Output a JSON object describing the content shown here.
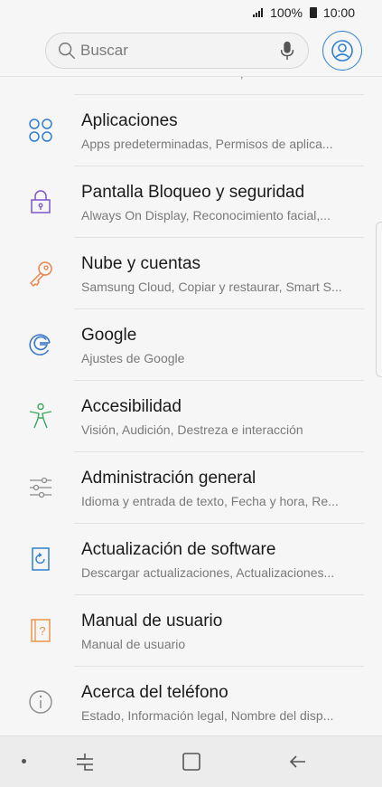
{
  "status_bar": {
    "battery": "100%",
    "time": "10:00"
  },
  "search": {
    "placeholder": "Buscar"
  },
  "items": [
    {
      "title": "Aplicaciones",
      "subtitle": "Apps predeterminadas, Permisos de aplica...",
      "icon": "apps-icon"
    },
    {
      "title": "Pantalla Bloqueo y seguridad",
      "subtitle": "Always On Display, Reconocimiento facial,...",
      "icon": "lock-icon"
    },
    {
      "title": "Nube y cuentas",
      "subtitle": "Samsung Cloud, Copiar y restaurar, Smart S...",
      "icon": "key-icon"
    },
    {
      "title": "Google",
      "subtitle": "Ajustes de Google",
      "icon": "google-icon"
    },
    {
      "title": "Accesibilidad",
      "subtitle": "Visión, Audición, Destreza e interacción",
      "icon": "accessibility-icon"
    },
    {
      "title": "Administración general",
      "subtitle": "Idioma y entrada de texto, Fecha y hora, Re...",
      "icon": "sliders-icon"
    },
    {
      "title": "Actualización de software",
      "subtitle": "Descargar actualizaciones, Actualizaciones...",
      "icon": "software-update-icon"
    },
    {
      "title": "Manual de usuario",
      "subtitle": "Manual de usuario",
      "icon": "user-manual-icon"
    },
    {
      "title": "Acerca del teléfono",
      "subtitle": "Estado, Información legal, Nombre del disp...",
      "icon": "info-icon"
    }
  ],
  "colors": {
    "apps": "#2f7fcf",
    "lock": "#7b55c9",
    "key": "#e8854a",
    "google": "#3a78c9",
    "accessibility": "#3aa65a",
    "admin": "#8a8a8a",
    "update": "#2f7fcf",
    "manual": "#e8954a",
    "info": "#8a8a8a"
  }
}
